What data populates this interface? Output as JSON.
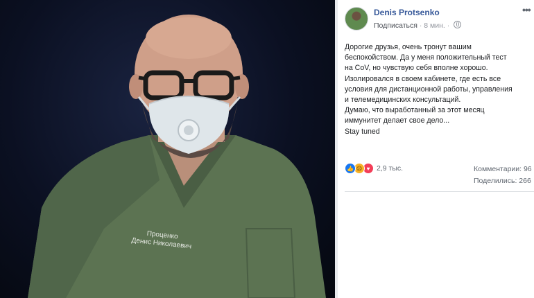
{
  "post": {
    "author": "Denis Protsenko",
    "subscribe_label": "Подписаться",
    "time": "8 мин.",
    "more_icon": "more-options-icon",
    "text_lines": [
      "Дорогие друзья, очень тронут вашим",
      "беспокойством. Да у меня положительный тест",
      "на CoV, но чувствую себя вполне хорошо.",
      "Изолировался в своем кабинете, где есть все",
      "условия для дистанционной работы, управления",
      "и телемедицинских консультаций.",
      "Думаю, что выработанный за этот месяц",
      "иммунитет делает свое дело...",
      "Stay tuned"
    ],
    "reactions_count": "2,9 тыс.",
    "comments_label": "Комментарии: 96",
    "shares_label": "Поделились: 266"
  },
  "photo": {
    "badge_line1": "Проценко",
    "badge_line2": "Денис Николаевич"
  }
}
